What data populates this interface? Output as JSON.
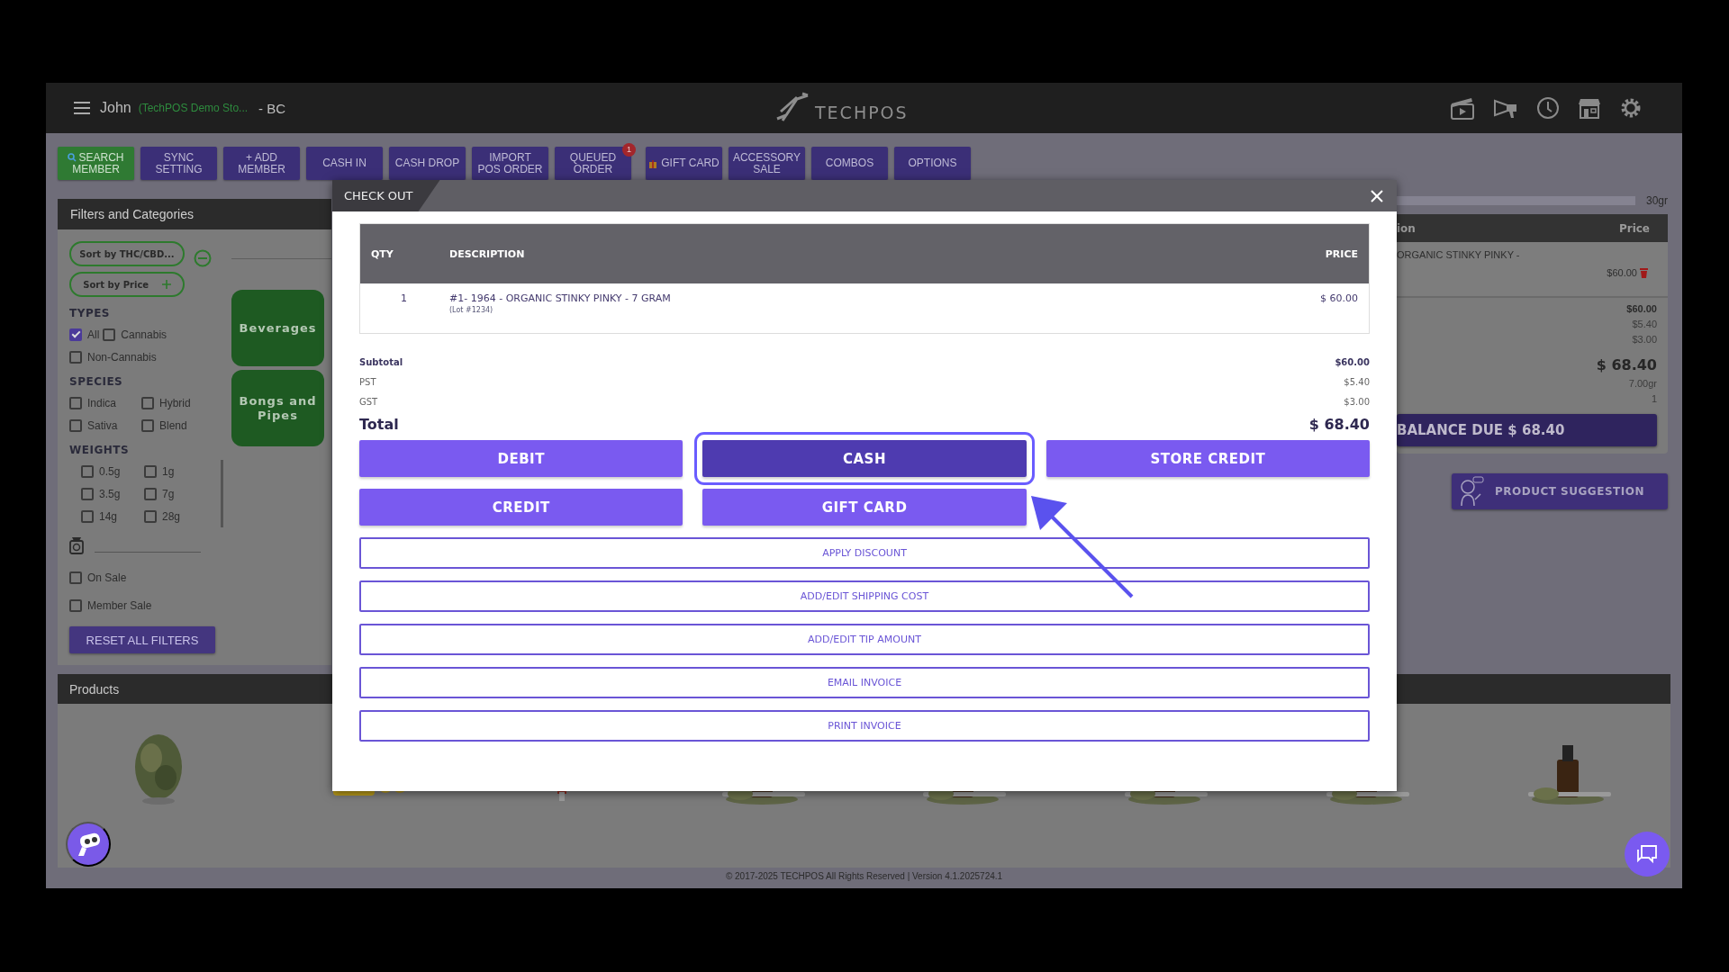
{
  "header": {
    "user": "John",
    "store": "(TechPOS Demo Sto...",
    "region": "- BC",
    "logo": "TECHPOS"
  },
  "toolbar": [
    {
      "lines": [
        "SEARCH",
        "MEMBER"
      ],
      "kind": "member"
    },
    {
      "lines": [
        "SYNC",
        "SETTING"
      ],
      "kind": "plain"
    },
    {
      "lines": [
        "+ ADD",
        "MEMBER"
      ],
      "kind": "plain"
    },
    {
      "lines": [
        "CASH IN"
      ],
      "kind": "plain"
    },
    {
      "lines": [
        "CASH DROP"
      ],
      "kind": "plain"
    },
    {
      "lines": [
        "IMPORT",
        "POS ORDER"
      ],
      "kind": "plain"
    },
    {
      "lines": [
        "QUEUED",
        "ORDER"
      ],
      "kind": "plain",
      "badge": "1"
    },
    {
      "lines": [
        "GIFT CARD"
      ],
      "kind": "gift"
    },
    {
      "lines": [
        "ACCESSORY",
        "SALE"
      ],
      "kind": "plain"
    },
    {
      "lines": [
        "COMBOS"
      ],
      "kind": "plain"
    },
    {
      "lines": [
        "OPTIONS"
      ],
      "kind": "plain"
    }
  ],
  "filters": {
    "title": "Filters and Categories",
    "sort": [
      {
        "label": "Sort by THC/CBD...",
        "kind": "minus"
      },
      {
        "label": "Sort by Price",
        "kind": "plus"
      }
    ],
    "types_title": "TYPES",
    "types": [
      {
        "label": "All",
        "checked": true
      },
      {
        "label": "Cannabis",
        "checked": false
      },
      {
        "label": "Non-Cannabis",
        "checked": false
      }
    ],
    "species_title": "SPECIES",
    "species": [
      {
        "label": "Indica",
        "checked": false
      },
      {
        "label": "Hybrid",
        "checked": false
      },
      {
        "label": "Sativa",
        "checked": false
      },
      {
        "label": "Blend",
        "checked": false
      }
    ],
    "weights_title": "WEIGHTS",
    "weights": [
      {
        "label": "0.5g",
        "checked": false
      },
      {
        "label": "1g",
        "checked": false
      },
      {
        "label": "3.5g",
        "checked": false
      },
      {
        "label": "7g",
        "checked": false
      },
      {
        "label": "14g",
        "checked": false
      },
      {
        "label": "28g",
        "checked": false
      }
    ],
    "sales": [
      {
        "label": "On Sale",
        "checked": false
      },
      {
        "label": "Member Sale",
        "checked": false
      }
    ],
    "reset": "RESET ALL FILTERS",
    "categories": [
      "Beverages",
      "Bongs and Pipes"
    ]
  },
  "cart": {
    "limit": "30gr",
    "weight_bar": {
      "level": 0
    },
    "columns": [
      "ion",
      "Price"
    ],
    "row": {
      "description": "ORGANIC STINKY PINKY -",
      "price": "$60.00"
    },
    "totals": [
      {
        "value": "$60.00",
        "kind": "bold"
      },
      {
        "value": "$5.40",
        "kind": "plain"
      },
      {
        "value": "$3.00",
        "kind": "plain"
      },
      {
        "value": "$ 68.40",
        "kind": "total"
      },
      {
        "value": "7.00gr",
        "kind": "plain"
      },
      {
        "value": "1",
        "kind": "plain"
      }
    ],
    "balance": "BALANCE DUE $ 68.40",
    "suggestion": "PRODUCT SUGGESTION"
  },
  "products": {
    "title": "Products"
  },
  "footer": "© 2017-2025 TECHPOS All Rights Reserved | Version 4.1.2025724.1",
  "checkout": {
    "title": "CHECK OUT",
    "columns": [
      "QTY",
      "DESCRIPTION",
      "PRICE"
    ],
    "rows": [
      {
        "qty": "1",
        "description": "#1- 1964 - ORGANIC STINKY PINKY - 7 GRAM",
        "lot": "(Lot #1234)",
        "price": "$ 60.00"
      }
    ],
    "summary": [
      {
        "label": "Subtotal",
        "value": "$60.00",
        "kind": "subtotal"
      },
      {
        "label": "PST",
        "value": "$5.40",
        "kind": "tax"
      },
      {
        "label": "GST",
        "value": "$3.00",
        "kind": "tax"
      },
      {
        "label": "Total",
        "value": "$ 68.40",
        "kind": "total"
      }
    ],
    "payments": [
      {
        "label": "DEBIT",
        "selected": false
      },
      {
        "label": "CASH",
        "selected": true
      },
      {
        "label": "STORE CREDIT",
        "selected": false
      },
      {
        "label": "CREDIT",
        "selected": false
      },
      {
        "label": "GIFT CARD",
        "selected": false
      }
    ],
    "actions": [
      "APPLY DISCOUNT",
      "ADD/EDIT SHIPPING COST",
      "ADD/EDIT TIP AMOUNT",
      "EMAIL INVOICE",
      "PRINT INVOICE"
    ]
  }
}
